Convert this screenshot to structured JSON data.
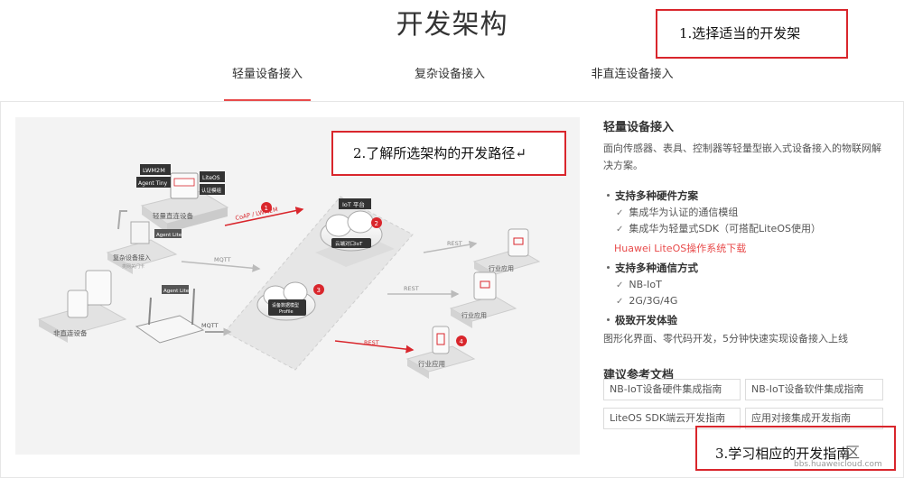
{
  "page": {
    "title": "开发架构"
  },
  "tabs": [
    {
      "label": "轻量设备接入",
      "active": true
    },
    {
      "label": "复杂设备接入",
      "active": false
    },
    {
      "label": "非直连设备接入",
      "active": false
    }
  ],
  "diagram": {
    "lightweight_device": "轻量直连设备",
    "lwm2m_tag": "LWM2M",
    "agent_tiny_tag": "Agent Tiny",
    "liteos_tag": "LiteOS",
    "cert_module_tag": "认证模组",
    "complex_device": "复杂设备接入",
    "complex_sub": "类网关门卡",
    "agent_lite_tag_1": "Agent Lite",
    "agent_lite_tag_2": "Agent Lite",
    "indirect_device": "非直连设备",
    "iot_platform": "IoT 平台",
    "platform_cloud": "云端对口IoT",
    "profile_cloud_1": "设备数据模型",
    "profile_cloud_2": "Profile",
    "protocol_coap": "CoAP / LWM2M",
    "protocol_mqtt_1": "MQTT",
    "protocol_mqtt_2": "MQTT",
    "rest_1": "REST",
    "rest_2": "REST",
    "rest_3": "REST",
    "app_1": "行业应用",
    "app_2": "行业应用",
    "app_3": "行业应用",
    "step_1": "1",
    "step_2": "2",
    "step_3": "3",
    "step_4": "4"
  },
  "sidebar": {
    "title": "轻量设备接入",
    "description": "面向传感器、表具、控制器等轻量型嵌入式设备接入的物联网解决方案。",
    "features": [
      {
        "heading": "支持多种硬件方案",
        "items": [
          "集成华为认证的通信模组",
          "集成华为轻量式SDK（可搭配LiteOS使用）"
        ],
        "link": "Huawei LiteOS操作系统下载"
      },
      {
        "heading": "支持多种通信方式",
        "items": [
          "NB-IoT",
          "2G/3G/4G"
        ]
      },
      {
        "heading": "极致开发体验",
        "text": "图形化界面、零代码开发，5分钟快速实现设备接入上线"
      }
    ],
    "docs_title": "建议参考文档",
    "docs": [
      "NB-IoT设备硬件集成指南",
      "NB-IoT设备软件集成指南",
      "LiteOS SDK端云开发指南",
      "应用对接集成开发指南"
    ]
  },
  "callouts": {
    "c1": "1.选择适当的开发架",
    "c2": "2.了解所选架构的开发路径↵",
    "c3": "3.学习相应的开发指南"
  },
  "watermark": {
    "text": "bbs.huaweicloud.com",
    "logo": "区"
  },
  "colors": {
    "accent": "#e84b4b",
    "callout_border": "#d9262c"
  }
}
